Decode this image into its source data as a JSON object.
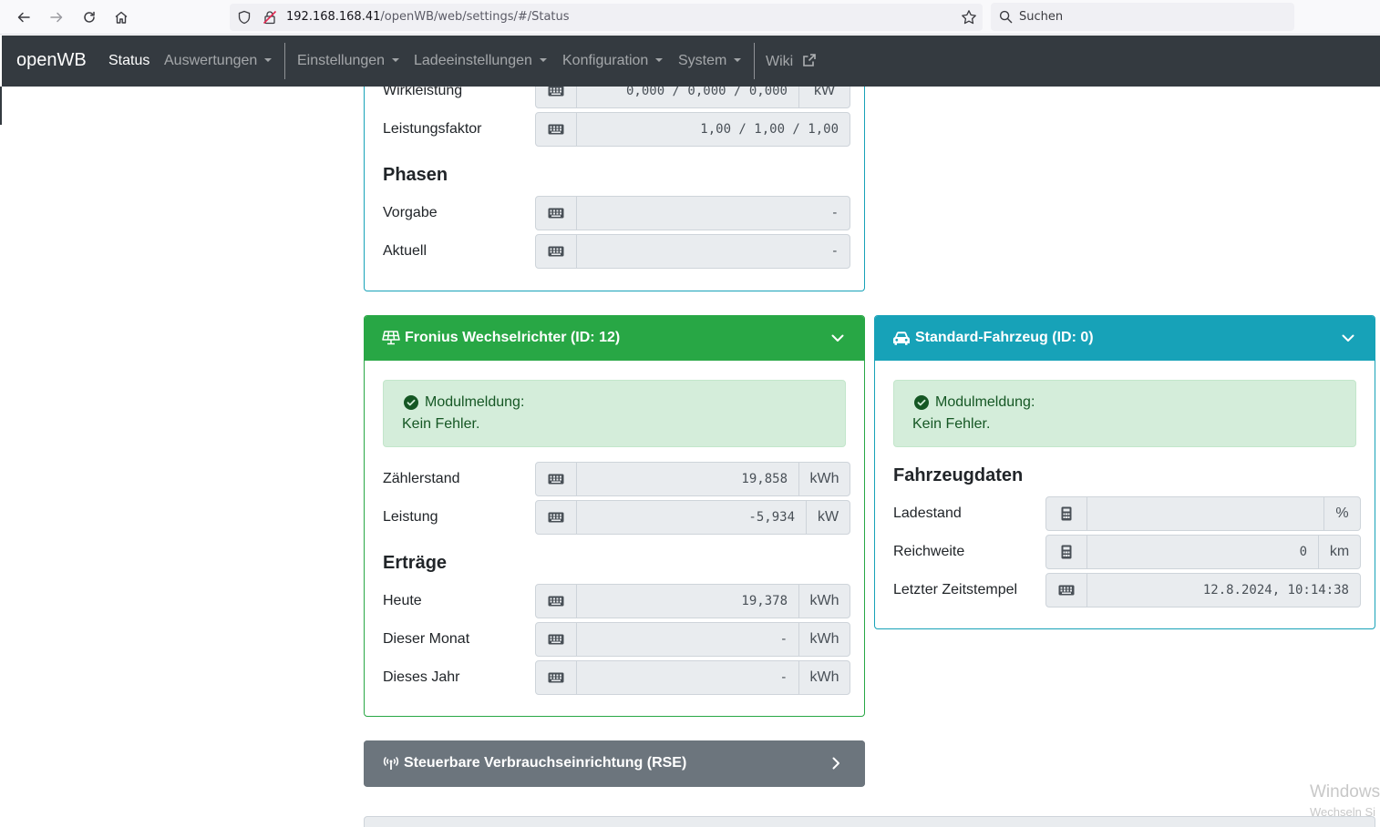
{
  "browser": {
    "url_host": "192.168.168.41",
    "url_path": "/openWB/web/settings/#/Status",
    "search_placeholder": "Suchen"
  },
  "navbar": {
    "brand": "openWB",
    "items": [
      {
        "label": "Status"
      },
      {
        "label": "Auswertungen"
      },
      {
        "label": "Einstellungen"
      },
      {
        "label": "Ladeeinstellungen"
      },
      {
        "label": "Konfiguration"
      },
      {
        "label": "System"
      },
      {
        "label": "Wiki"
      }
    ]
  },
  "top_card": {
    "rows": [
      {
        "label": "Wirkleistung",
        "value": "0,000 / 0,000 / 0,000",
        "unit": "kW"
      },
      {
        "label": "Leistungsfaktor",
        "value": "1,00 / 1,00 / 1,00"
      }
    ],
    "phasen": {
      "heading": "Phasen",
      "rows": [
        {
          "label": "Vorgabe",
          "value": "-"
        },
        {
          "label": "Aktuell",
          "value": "-"
        }
      ]
    }
  },
  "inverter_card": {
    "title": "Fronius Wechselrichter (ID: 12)",
    "alert_title": "Modulmeldung:",
    "alert_text": "Kein Fehler.",
    "rows": [
      {
        "label": "Zählerstand",
        "value": "19,858",
        "unit": "kWh"
      },
      {
        "label": "Leistung",
        "value": "-5,934",
        "unit": "kW"
      }
    ],
    "ertraege": {
      "heading": "Erträge",
      "rows": [
        {
          "label": "Heute",
          "value": "19,378",
          "unit": "kWh"
        },
        {
          "label": "Dieser Monat",
          "value": "-",
          "unit": "kWh"
        },
        {
          "label": "Dieses Jahr",
          "value": "-",
          "unit": "kWh"
        }
      ]
    }
  },
  "vehicle_card": {
    "title": "Standard-Fahrzeug (ID: 0)",
    "alert_title": "Modulmeldung:",
    "alert_text": "Kein Fehler.",
    "heading": "Fahrzeugdaten",
    "rows": [
      {
        "label": "Ladestand",
        "value": "",
        "unit": "%"
      },
      {
        "label": "Reichweite",
        "value": "0",
        "unit": "km"
      },
      {
        "label": "Letzter Zeitstempel",
        "value": "12.8.2024, 10:14:38"
      }
    ]
  },
  "rse_card": {
    "title": "Steuerbare Verbrauchseinrichtung (RSE)"
  },
  "watermark": {
    "line1": "Windows",
    "line2": "Wechseln Si"
  },
  "colors": {
    "navbar": "#343a40",
    "success": "#28a745",
    "info": "#17a2b8",
    "secondary": "#6c757d",
    "alert_bg": "#d4edda",
    "alert_text": "#155724"
  }
}
